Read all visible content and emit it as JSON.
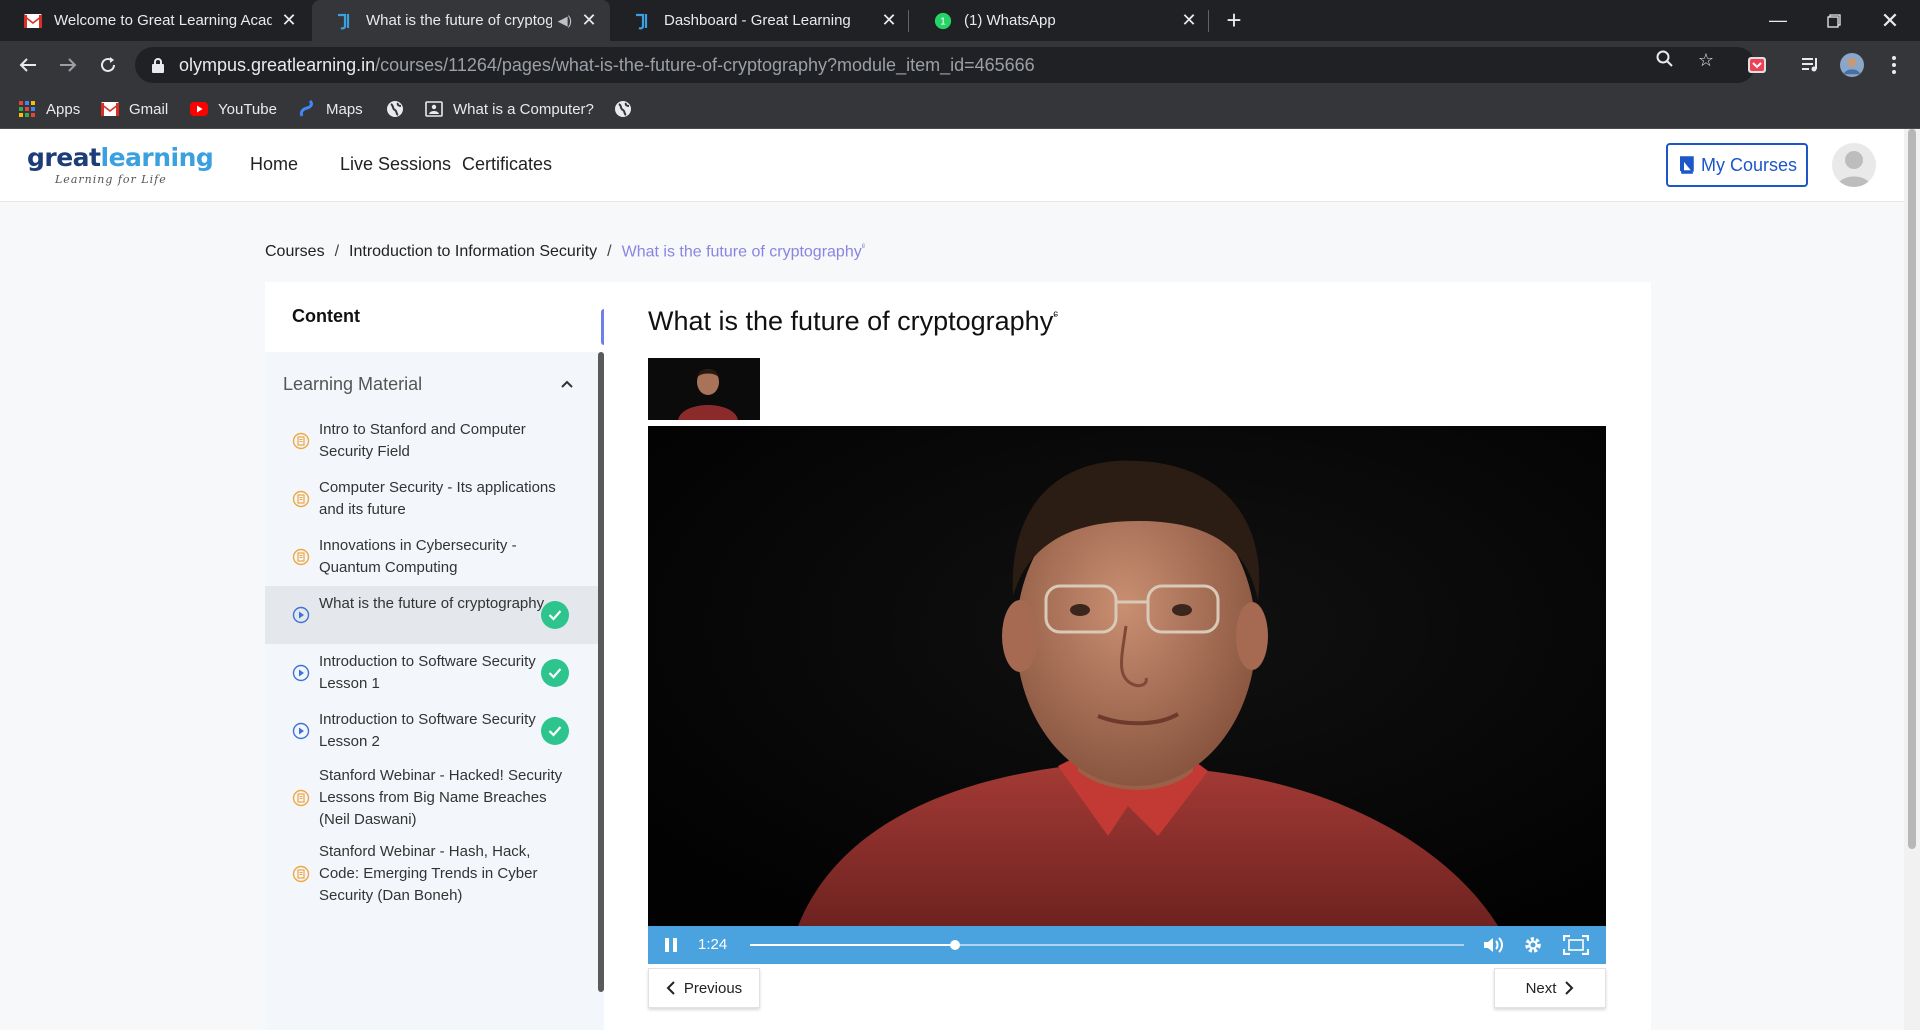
{
  "browser": {
    "tabs": [
      {
        "title": "Welcome to Great Learning Acad",
        "favicon": "gmail-icon"
      },
      {
        "title": "What is the future of cryptog",
        "favicon": "greatlearning-icon",
        "audio": true
      },
      {
        "title": "Dashboard - Great Learning",
        "favicon": "greatlearning-icon"
      },
      {
        "title": "(1) WhatsApp",
        "favicon": "whatsapp-icon",
        "badge": "1"
      }
    ],
    "url": {
      "host": "olympus.greatlearning.in",
      "path": "/courses/11264/pages/what-is-the-future-of-cryptography?module_item_id=465666"
    },
    "bookmarks": [
      {
        "label": "Apps",
        "icon": "apps-grid-icon"
      },
      {
        "label": "Gmail",
        "icon": "gmail-icon"
      },
      {
        "label": "YouTube",
        "icon": "youtube-icon"
      },
      {
        "label": "Maps",
        "icon": "maps-icon"
      },
      {
        "label": "",
        "icon": "globe-icon"
      },
      {
        "label": "What is a Computer?",
        "icon": "page-icon"
      },
      {
        "label": "",
        "icon": "globe-icon"
      }
    ]
  },
  "site": {
    "logo": {
      "great": "great",
      "learning": "learning",
      "tagline": "Learning for Life"
    },
    "nav": [
      "Home",
      "Live Sessions",
      "Certificates"
    ],
    "my_courses": "My Courses"
  },
  "breadcrumb": {
    "items": [
      "Courses",
      "Introduction to Information Security"
    ],
    "separator": "/",
    "current": "What is the future of cryptography"
  },
  "sidebar": {
    "title": "Content",
    "module": "Learning Material",
    "items": [
      {
        "label": "Intro to Stanford and Computer Security Field",
        "type": "pdf-icon",
        "done": false,
        "active": false
      },
      {
        "label": "Computer Security - Its applications and its future",
        "type": "pdf-icon",
        "done": false,
        "active": false
      },
      {
        "label": "Innovations in Cybersecurity - Quantum Computing",
        "type": "pdf-icon",
        "done": false,
        "active": false
      },
      {
        "label": "What is the future of cryptography",
        "type": "play-icon",
        "done": true,
        "active": true
      },
      {
        "label": "Introduction to Software Security Lesson 1",
        "type": "play-icon",
        "done": true,
        "active": false
      },
      {
        "label": "Introduction to Software Security Lesson 2",
        "type": "play-icon",
        "done": true,
        "active": false
      },
      {
        "label": "Stanford Webinar - Hacked! Security Lessons from Big Name Breaches (Neil Daswani)",
        "type": "pdf-icon",
        "done": false,
        "active": false
      },
      {
        "label": "Stanford Webinar - Hash, Hack, Code: Emerging Trends in Cyber Security (Dan Boneh)",
        "type": "pdf-icon",
        "done": false,
        "active": false
      }
    ]
  },
  "lesson": {
    "title": "What is the future of cryptography",
    "player": {
      "time": "1:24",
      "progress": 0.287
    },
    "prev_label": "Previous",
    "next_label": "Next"
  },
  "colors": {
    "accent": "#1c56c9",
    "breadcrumb_current": "#8a84e2",
    "player_bar": "#4aa3df",
    "done_check": "#2dc48d",
    "chrome_dark": "#202124",
    "chrome_mid": "#35363a"
  }
}
